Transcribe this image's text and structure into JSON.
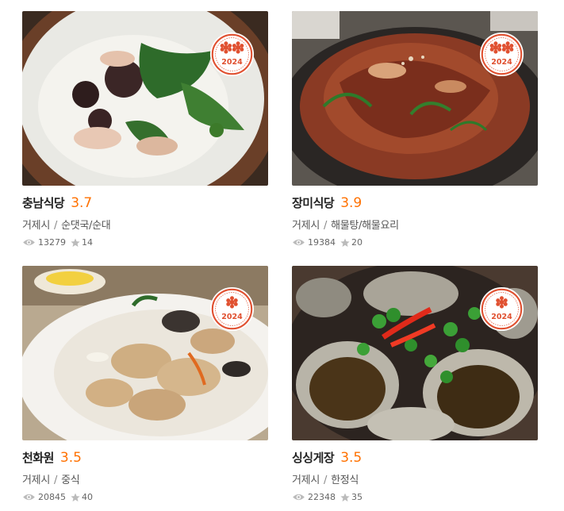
{
  "accent_color": "#ff7100",
  "badge_color": "#e05030",
  "restaurants": [
    {
      "name": "충남식당",
      "rating": "3.7",
      "region": "거제시",
      "category": "순댓국/순대",
      "views": "13279",
      "stars": "14",
      "badge": {
        "year": "2024",
        "level": 2,
        "icon": "flower-icon"
      },
      "photo_icon": "sundae-soup-photo"
    },
    {
      "name": "장미식당",
      "rating": "3.9",
      "region": "거제시",
      "category": "해물탕/해물요리",
      "views": "19384",
      "stars": "20",
      "badge": {
        "year": "2024",
        "level": 2,
        "icon": "flower-icon"
      },
      "photo_icon": "braised-fish-photo"
    },
    {
      "name": "천화원",
      "rating": "3.5",
      "region": "거제시",
      "category": "중식",
      "views": "20845",
      "stars": "40",
      "badge": {
        "year": "2024",
        "level": 1,
        "icon": "flower-icon"
      },
      "photo_icon": "sweet-sour-pork-photo"
    },
    {
      "name": "싱싱게장",
      "rating": "3.5",
      "region": "거제시",
      "category": "한정식",
      "views": "22348",
      "stars": "35",
      "badge": {
        "year": "2024",
        "level": 1,
        "icon": "flower-icon"
      },
      "photo_icon": "crab-photo"
    }
  ]
}
